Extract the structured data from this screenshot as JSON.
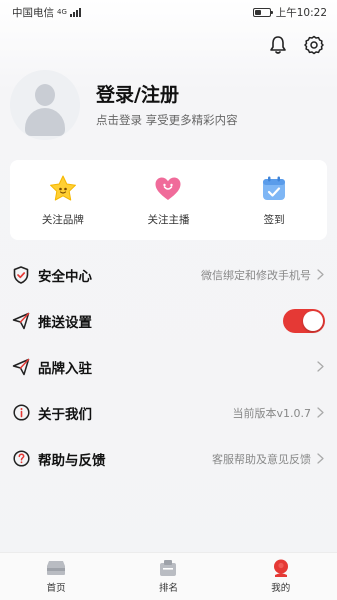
{
  "status_bar": {
    "carrier": "中国电信",
    "network": "4G",
    "battery_percent": 40,
    "time": "上午10:22"
  },
  "header": {
    "bell_icon": "bell-icon",
    "settings_icon": "gear-icon"
  },
  "profile": {
    "title": "登录/注册",
    "subtitle": "点击登录 享受更多精彩内容"
  },
  "quick_actions": [
    {
      "label": "关注品牌",
      "icon": "star-icon"
    },
    {
      "label": "关注主播",
      "icon": "heart-icon"
    },
    {
      "label": "签到",
      "icon": "calendar-check-icon"
    }
  ],
  "menu": [
    {
      "title": "安全中心",
      "hint": "微信绑定和修改手机号",
      "icon": "shield-check-icon"
    },
    {
      "title": "推送设置",
      "hint": "",
      "icon": "send-icon",
      "toggle_on": true
    },
    {
      "title": "品牌入驻",
      "hint": "",
      "icon": "send-icon"
    },
    {
      "title": "关于我们",
      "hint": "当前版本v1.0.7",
      "icon": "info-icon"
    },
    {
      "title": "帮助与反馈",
      "hint": "客服帮助及意见反馈",
      "icon": "help-icon"
    }
  ],
  "bottom_nav": [
    {
      "label": "首页",
      "icon": "home-icon"
    },
    {
      "label": "排名",
      "icon": "ranking-icon"
    },
    {
      "label": "我的",
      "icon": "user-icon"
    }
  ],
  "colors": {
    "accent": "#e53935",
    "toggle_on": "#e53935"
  }
}
